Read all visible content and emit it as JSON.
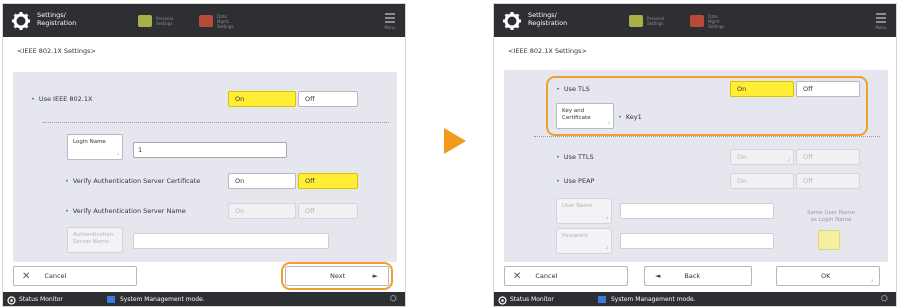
{
  "header": {
    "title": "Settings/\nRegistration",
    "shortcut1": "Personal\nSettings",
    "shortcut2": "Data Mgmt.\nSettings",
    "menu_label": "Menu"
  },
  "left": {
    "breadcrumb": "<IEEE 802.1X Settings>",
    "use_ieee_label": "Use IEEE 802.1X",
    "on": "On",
    "off": "Off",
    "login_name_label": "Login Name",
    "login_name_value": "1",
    "verify_cert_label": "Verify Authentication Server Certificate",
    "verify_name_label": "Verify Authentication Server Name",
    "auth_server_name_label": "Authentication\nServer Name",
    "cancel": "Cancel",
    "next": "Next"
  },
  "right": {
    "breadcrumb": "<IEEE 802.1X Settings>",
    "use_tls_label": "Use TLS",
    "on": "On",
    "off": "Off",
    "key_cert_label": "Key and\nCertificate",
    "key_value": "Key1",
    "use_ttls_label": "Use TTLS",
    "use_peap_label": "Use PEAP",
    "user_name_label": "User Name",
    "password_label": "Password",
    "same_user_label": "Same User Name\nas Login Name",
    "cancel": "Cancel",
    "back": "Back",
    "ok": "OK"
  },
  "statusbar": {
    "status_monitor": "Status Monitor",
    "system_mode": "System Management mode."
  },
  "colors": {
    "accent_on": "#ffee33",
    "highlight": "#f0a030",
    "arrow": "#f39a1c",
    "header": "#2e2f33",
    "content_bg": "#e6e6ee"
  },
  "icons": [
    "gear-icon",
    "shortcut-icon",
    "menu-icon",
    "close-icon",
    "play-icon",
    "back-arrow-icon",
    "status-monitor-icon",
    "system-icon",
    "remote-icon"
  ]
}
